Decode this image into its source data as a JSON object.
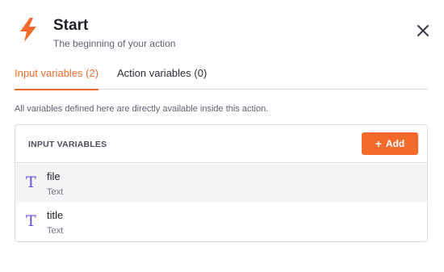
{
  "header": {
    "title": "Start",
    "subtitle": "The beginning of your action",
    "icon": "lightning-bolt-icon",
    "accent_color": "#f26b2c"
  },
  "tabs": [
    {
      "label": "Input variables (2)",
      "active": true
    },
    {
      "label": "Action variables (0)",
      "active": false
    }
  ],
  "description": "All variables defined here are directly available inside this action.",
  "panel": {
    "header_label": "INPUT VARIABLES",
    "add_label": "Add",
    "add_icon": "+",
    "rows": [
      {
        "icon": "T",
        "name": "file",
        "type": "Text"
      },
      {
        "icon": "T",
        "name": "title",
        "type": "Text"
      }
    ]
  }
}
